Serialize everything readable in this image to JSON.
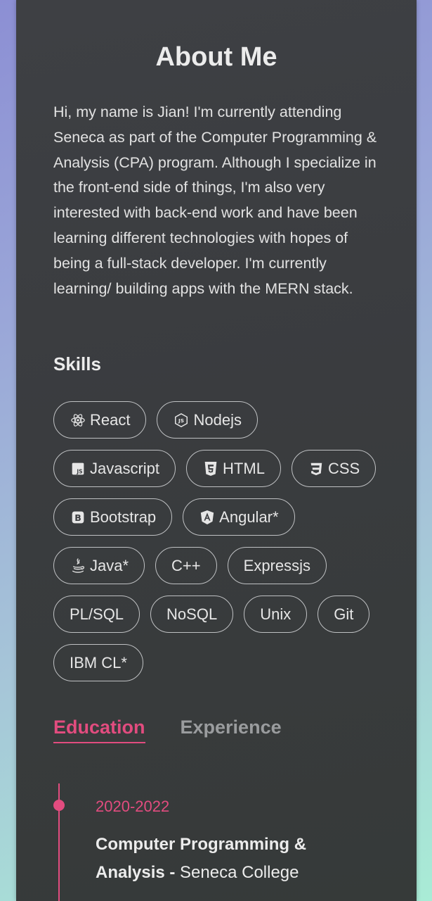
{
  "about": {
    "title": "About Me",
    "bio": "Hi, my name is Jian! I'm currently attending Seneca as part of the Computer Programming & Analysis (CPA) program. Although I specialize in the front-end side of things, I'm also very interested with back-end work and have been learning different technologies with hopes of being a full-stack developer. I'm currently learning/ building apps with the MERN stack."
  },
  "skills": {
    "heading": "Skills",
    "items": [
      {
        "label": "React",
        "icon": "react-icon"
      },
      {
        "label": "Nodejs",
        "icon": "nodejs-icon"
      },
      {
        "label": "Javascript",
        "icon": "javascript-icon"
      },
      {
        "label": "HTML",
        "icon": "html5-icon"
      },
      {
        "label": "CSS",
        "icon": "css3-icon"
      },
      {
        "label": "Bootstrap",
        "icon": "bootstrap-icon"
      },
      {
        "label": "Angular*",
        "icon": "angular-icon"
      },
      {
        "label": "Java*",
        "icon": "java-icon"
      },
      {
        "label": "C++",
        "icon": ""
      },
      {
        "label": "Expressjs",
        "icon": ""
      },
      {
        "label": "PL/SQL",
        "icon": ""
      },
      {
        "label": "NoSQL",
        "icon": ""
      },
      {
        "label": "Unix",
        "icon": ""
      },
      {
        "label": "Git",
        "icon": ""
      },
      {
        "label": "IBM CL*",
        "icon": ""
      }
    ]
  },
  "tabs": [
    {
      "label": "Education",
      "active": true
    },
    {
      "label": "Experience",
      "active": false
    }
  ],
  "education": [
    {
      "date": "2020-2022",
      "program": "Computer Programming & Analysis",
      "separator": " - ",
      "school": "Seneca College"
    }
  ],
  "colors": {
    "accent": "#e24c7f",
    "card": "#3c3e41",
    "text": "#ececec"
  }
}
